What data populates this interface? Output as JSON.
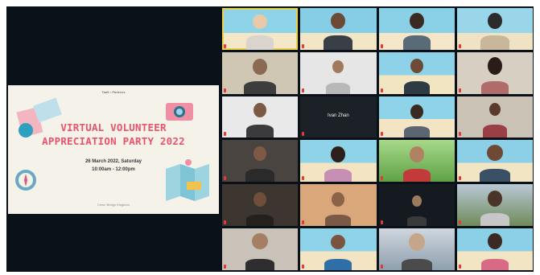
{
  "slide": {
    "logos": "TaaS • Partners",
    "title_line1": "VIRTUAL VOLUNTEER",
    "title_line2": "APPRECIATION PARTY 2022",
    "date": "26 March 2022, Saturday",
    "time": "10:00am - 12:00pm",
    "credit": "Crew: Bridge Kingdom"
  },
  "gallery": {
    "center_name": "Ivan Zhan"
  },
  "colors": {
    "stage": "#0b1118",
    "title_pink": "#e8546b",
    "active_speaker": "#e8d34a",
    "mic_muted": "#e53935"
  }
}
